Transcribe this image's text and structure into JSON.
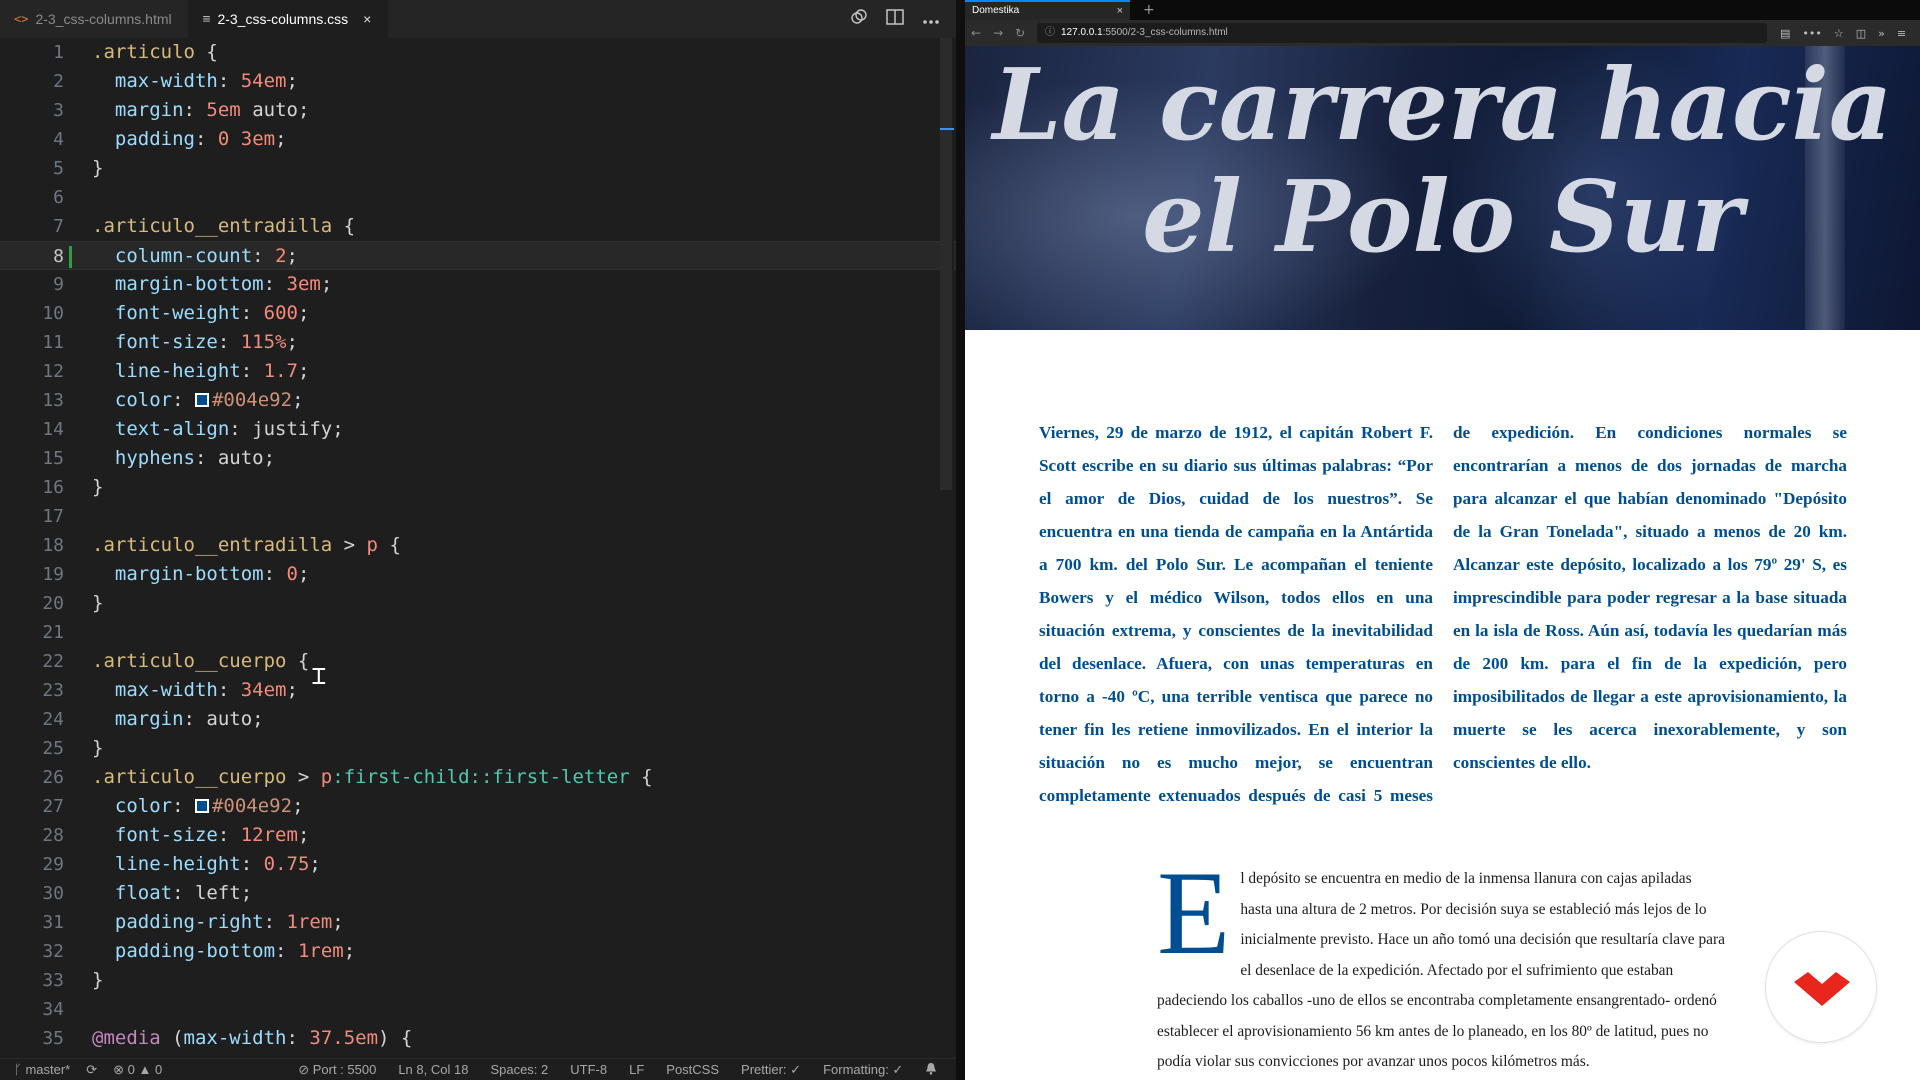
{
  "editor": {
    "tabs": [
      {
        "icon": "<>",
        "label": "2-3_css-columns.html",
        "active": false
      },
      {
        "icon": "≡",
        "label": "2-3_css-columns.css",
        "active": true,
        "close": "×"
      }
    ],
    "current_line": 8,
    "lines": [
      {
        "n": "1",
        "html": "<span class='t-sel'>.articulo</span> <span class='t-pun'>{</span>"
      },
      {
        "n": "2",
        "html": "  <span class='t-prop'>max-width</span>: <span class='t-num'>54em</span>;"
      },
      {
        "n": "3",
        "html": "  <span class='t-prop'>margin</span>: <span class='t-num'>5em</span> auto;"
      },
      {
        "n": "4",
        "html": "  <span class='t-prop'>padding</span>: <span class='t-num'>0</span> <span class='t-num'>3em</span>;"
      },
      {
        "n": "5",
        "html": "}"
      },
      {
        "n": "6",
        "html": ""
      },
      {
        "n": "7",
        "html": "<span class='t-sel'>.articulo__entradilla</span> {"
      },
      {
        "n": "8",
        "html": "  <span class='t-prop'>column-count</span>: <span class='t-num'>2</span>;"
      },
      {
        "n": "9",
        "html": "  <span class='t-prop'>margin-bottom</span>: <span class='t-num'>3em</span>;"
      },
      {
        "n": "10",
        "html": "  <span class='t-prop'>font-weight</span>: <span class='t-num'>600</span>;"
      },
      {
        "n": "11",
        "html": "  <span class='t-prop'>font-size</span>: <span class='t-num'>115%</span>;"
      },
      {
        "n": "12",
        "html": "  <span class='t-prop'>line-height</span>: <span class='t-num'>1.7</span>;"
      },
      {
        "n": "13",
        "html": "  <span class='t-prop'>color</span>: <span class='swatch'></span><span class='t-val'>#004e92</span>;"
      },
      {
        "n": "14",
        "html": "  <span class='t-prop'>text-align</span>: justify;"
      },
      {
        "n": "15",
        "html": "  <span class='t-prop'>hyphens</span>: auto;"
      },
      {
        "n": "16",
        "html": "}"
      },
      {
        "n": "17",
        "html": ""
      },
      {
        "n": "18",
        "html": "<span class='t-sel'>.articulo__entradilla</span> &gt; <span class='t-tag'>p</span> {"
      },
      {
        "n": "19",
        "html": "  <span class='t-prop'>margin-bottom</span>: <span class='t-num'>0</span>;"
      },
      {
        "n": "20",
        "html": "}"
      },
      {
        "n": "21",
        "html": ""
      },
      {
        "n": "22",
        "html": "<span class='t-sel'>.articulo__cuerpo</span> {"
      },
      {
        "n": "23",
        "html": "  <span class='t-prop'>max-width</span>: <span class='t-num'>34em</span>;"
      },
      {
        "n": "24",
        "html": "  <span class='t-prop'>margin</span>: auto;"
      },
      {
        "n": "25",
        "html": "}"
      },
      {
        "n": "26",
        "html": "<span class='t-sel'>.articulo__cuerpo</span> &gt; <span class='t-tag'>p</span><span class='t-pseudo'>:first-child::first-letter</span> {"
      },
      {
        "n": "27",
        "html": "  <span class='t-prop'>color</span>: <span class='swatch'></span><span class='t-val'>#004e92</span>;"
      },
      {
        "n": "28",
        "html": "  <span class='t-prop'>font-size</span>: <span class='t-num'>12rem</span>;"
      },
      {
        "n": "29",
        "html": "  <span class='t-prop'>line-height</span>: <span class='t-num'>0.75</span>;"
      },
      {
        "n": "30",
        "html": "  <span class='t-prop'>float</span>: left;"
      },
      {
        "n": "31",
        "html": "  <span class='t-prop'>padding-right</span>: <span class='t-num'>1rem</span>;"
      },
      {
        "n": "32",
        "html": "  <span class='t-prop'>padding-bottom</span>: <span class='t-num'>1rem</span>;"
      },
      {
        "n": "33",
        "html": "}"
      },
      {
        "n": "34",
        "html": ""
      },
      {
        "n": "35",
        "html": "<span class='t-at'>@media</span> (<span class='t-prop'>max-width</span>: <span class='t-num'>37.5em</span>) {"
      }
    ],
    "icons": [
      "compare-icon",
      "split-editor-icon",
      "more-actions-icon"
    ]
  },
  "status": {
    "branch": "master*",
    "sync": "⟳",
    "errors": "⊗ 0",
    "warnings": "▲ 0",
    "port": "⊘ Port : 5500",
    "position": "Ln 8, Col 18",
    "spaces": "Spaces: 2",
    "encoding": "UTF-8",
    "eol": "LF",
    "language": "PostCSS",
    "prettier": "Prettier: ✓",
    "formatting": "Formatting: ✓",
    "bell": "🔔"
  },
  "browser": {
    "tab_label": "Domestika",
    "tab_close": "×",
    "new_tab": "+",
    "url_host": "127.0.0.1",
    "url_path": ":5500/2-3_css-columns.html",
    "page": {
      "hero_title_line1": "La carrera hacia",
      "hero_title_line2": "el Polo Sur",
      "lede": "Viernes, 29 de marzo de 1912, el capitán Robert F. Scott escribe en su diario sus últimas palabras: “Por el amor de Dios, cuidad de los nuestros”. Se encuentra en una tienda de campaña en la Antártida a 700 km. del Polo Sur. Le acompañan el teniente Bowers y el médico Wilson, todos ellos en una situación extrema, y conscientes de la inevitabilidad del desenlace. Afuera, con unas temperaturas en torno a -40 ºC, una terrible ventisca que parece no tener fin les retiene inmovilizados. En el interior la situación no es mucho mejor, se encuentran completamente extenuados después de casi 5 meses de expedición. En condiciones normales se encontrarían a menos de dos jornadas de marcha para alcanzar el que habían denominado \"Depósito de la Gran Tonelada\", situado a menos de 20 km. Alcanzar este depósito, localizado a los 79º 29' S, es imprescindible para poder regresar a la base situada en la isla de Ross. Aún así, todavía les quedarían más de 200 km. para el fin de la expedición, pero imposibilitados de llegar a este aprovisionamiento, la muerte se les acerca inexorablemente, y son conscientes de ello.",
      "dropcap": "E",
      "body": "l depósito se encuentra en medio de la inmensa llanura con cajas apiladas hasta una altura de 2 metros. Por decisión suya se estableció más lejos de lo inicialmente previsto. Hace un año tomó una decisión que resultaría clave para el desenlace de la expedición. Afectado por el sufrimiento que estaban padeciendo los caballos -uno de ellos se encontraba completamente ensangrentado- ordenó establecer el aprovisionamiento 56 km antes de lo planeado, en los 80º de latitud, pues no podía violar sus convicciones por avanzar unos pocos kilómetros más."
    }
  },
  "colors": {
    "accent_blue": "#004e92",
    "logo_red": "#e8261c",
    "editor_bg": "#1e1e1e"
  }
}
